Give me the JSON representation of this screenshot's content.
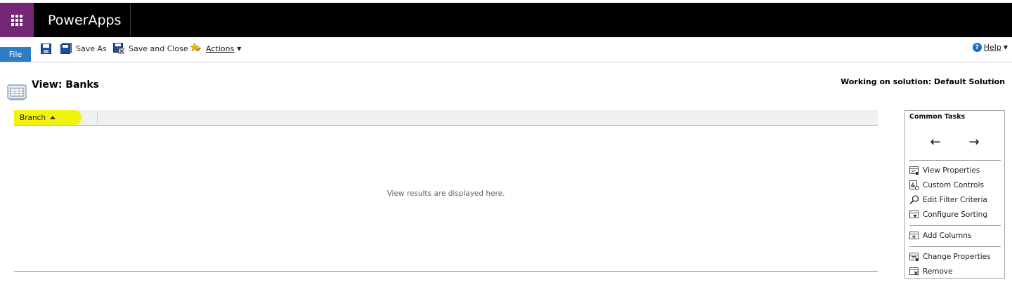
{
  "app": {
    "title": "PowerApps"
  },
  "toolbar": {
    "file_label": "File",
    "save_as_label": "Save As",
    "save_close_label": "Save and Close",
    "actions_label": "Actions",
    "help_label": "Help"
  },
  "header": {
    "view_title": "View: Banks",
    "solution_text": "Working on solution: Default Solution"
  },
  "grid": {
    "columns": [
      {
        "label": "Branch",
        "sort": "ascending"
      }
    ],
    "empty_message": "View results are displayed here."
  },
  "common_tasks": {
    "title": "Common Tasks",
    "left_arrow": "←",
    "right_arrow": "→",
    "items": [
      {
        "label": "View Properties",
        "icon": "view-properties-icon"
      },
      {
        "label": "Custom Controls",
        "icon": "custom-controls-icon"
      },
      {
        "label": "Edit Filter Criteria",
        "icon": "magnifier-icon"
      },
      {
        "label": "Configure Sorting",
        "icon": "sort-icon"
      },
      {
        "label": "Add Columns",
        "icon": "add-columns-icon"
      },
      {
        "label": "Change Properties",
        "icon": "change-properties-icon"
      },
      {
        "label": "Remove",
        "icon": "remove-icon"
      }
    ]
  },
  "colors": {
    "topbar": "#000000",
    "waffle": "#742774",
    "file_button": "#2d7dc3",
    "highlight": "#f2f20f"
  }
}
